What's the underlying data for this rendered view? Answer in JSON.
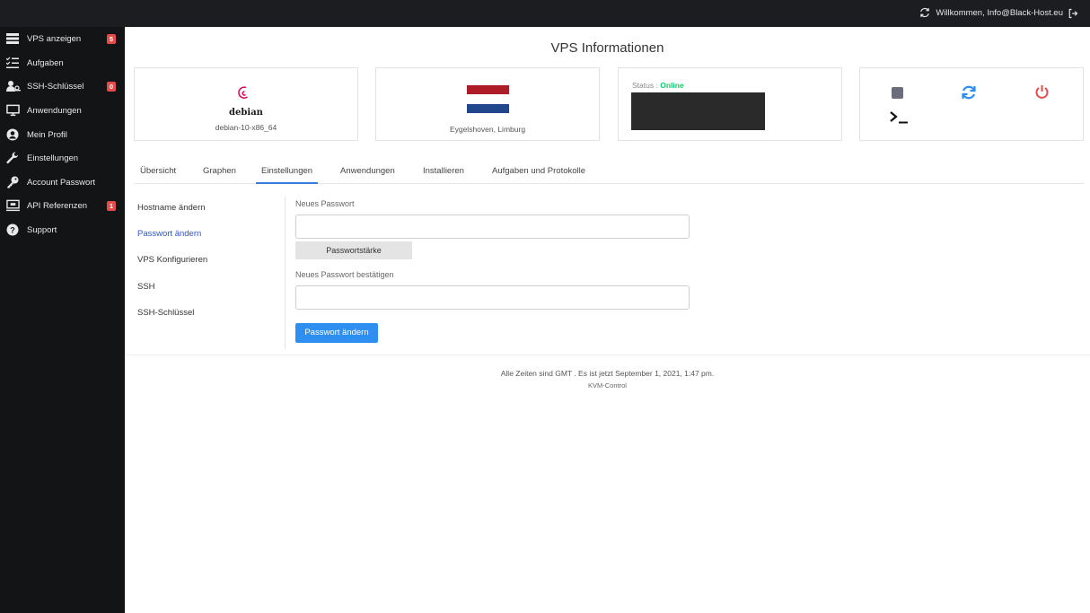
{
  "topbar": {
    "welcome": "Willkommen, Info@Black-Host.eu"
  },
  "sidebar": {
    "items": [
      {
        "label": "VPS anzeigen",
        "icon": "server-icon",
        "badge": "5"
      },
      {
        "label": "Aufgaben",
        "icon": "tasks-icon",
        "badge": ""
      },
      {
        "label": "SSH-Schlüssel",
        "icon": "users-key-icon",
        "badge": "0"
      },
      {
        "label": "Anwendungen",
        "icon": "monitor-icon",
        "badge": ""
      },
      {
        "label": "Mein Profil",
        "icon": "user-circle-icon",
        "badge": ""
      },
      {
        "label": "Einstellungen",
        "icon": "wrench-icon",
        "badge": ""
      },
      {
        "label": "Account Passwort",
        "icon": "key-icon",
        "badge": ""
      },
      {
        "label": "API Referenzen",
        "icon": "api-icon",
        "badge": "1"
      },
      {
        "label": "Support",
        "icon": "help-icon",
        "badge": ""
      }
    ]
  },
  "main": {
    "title": "VPS Informationen",
    "os": {
      "logo_text": "debian",
      "name": "debian-10-x86_64"
    },
    "location": "Eygelshoven, Limburg",
    "status": {
      "label": "Status :",
      "value": "Online",
      "value_color": "#19c86b"
    },
    "tabs": [
      {
        "label": "Übersicht"
      },
      {
        "label": "Graphen"
      },
      {
        "label": "Einstellungen"
      },
      {
        "label": "Anwendungen"
      },
      {
        "label": "Installieren"
      },
      {
        "label": "Aufgaben und Protokolle"
      }
    ],
    "active_tab": "Einstellungen",
    "submenu": [
      {
        "label": "Hostname ändern"
      },
      {
        "label": "Passwort ändern"
      },
      {
        "label": "VPS Konfigurieren"
      },
      {
        "label": "SSH"
      },
      {
        "label": "SSH-Schlüssel"
      }
    ],
    "form": {
      "new_password_label": "Neues Passwort",
      "new_password_value": "",
      "strength_label": "Passwortstärke",
      "confirm_label": "Neues Passwort bestätigen",
      "confirm_value": "",
      "submit_label": "Passwort ändern"
    }
  },
  "footer": {
    "time": "Alle Zeiten sind GMT . Es ist jetzt September 1, 2021, 1:47 pm.",
    "brand": "KVM-Control"
  },
  "colors": {
    "accent": "#2f8ff0",
    "badge": "#e44b4b",
    "sidebar_bg": "#131416",
    "online": "#19c86b",
    "power": "#e24a4a"
  }
}
